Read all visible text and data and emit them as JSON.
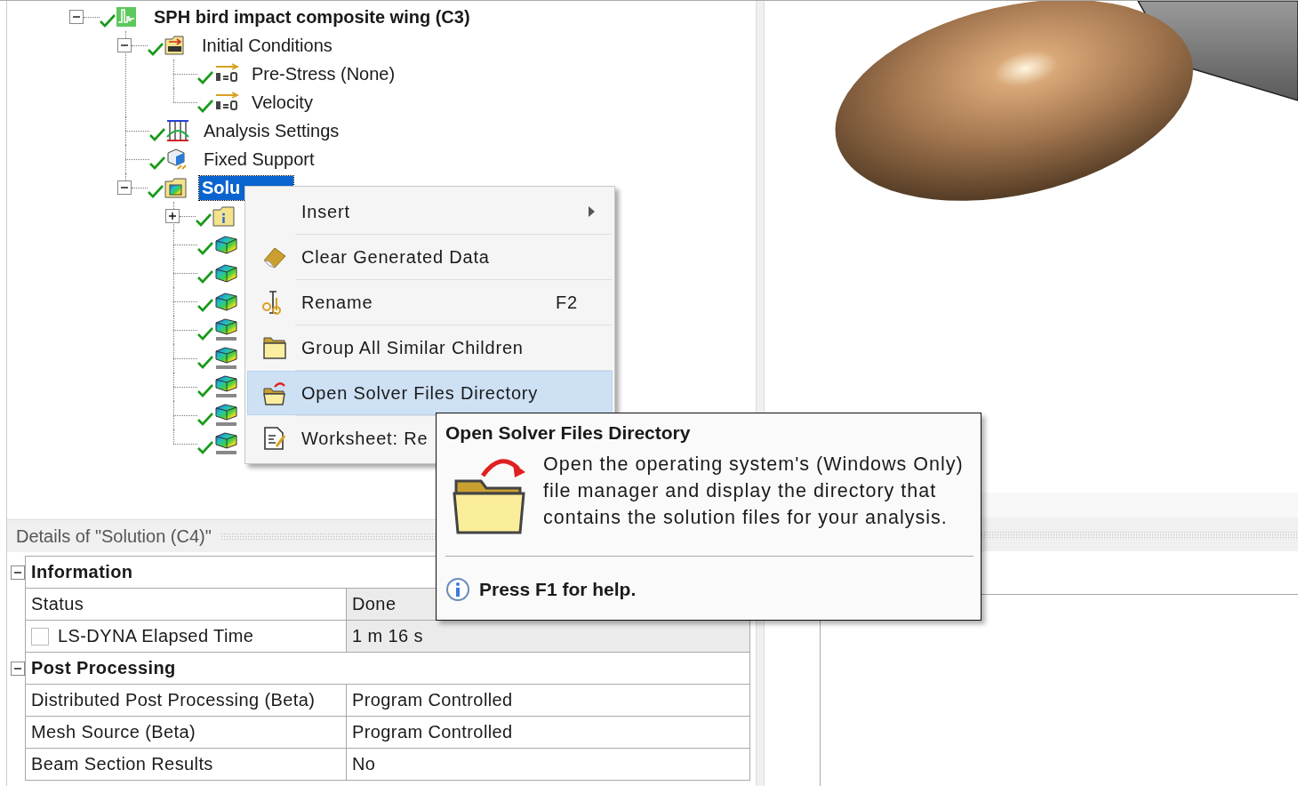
{
  "tree": {
    "nodes": [
      {
        "label": "SPH bird impact composite wing (C3)",
        "kind": "model",
        "solved": true,
        "expanded": true,
        "selected": false,
        "children": [
          {
            "label": "Initial Conditions",
            "kind": "initial-conditions",
            "solved": true,
            "expanded": true,
            "selected": false,
            "children": [
              {
                "label": "Pre-Stress (None)",
                "kind": "t0-arrow",
                "solved": true,
                "selected": false
              },
              {
                "label": "Velocity",
                "kind": "t0-arrow",
                "solved": true,
                "selected": false
              }
            ]
          },
          {
            "label": "Analysis Settings",
            "kind": "analysis-settings",
            "solved": true,
            "selected": false
          },
          {
            "label": "Fixed Support",
            "kind": "fixed-support",
            "solved": true,
            "selected": false
          },
          {
            "label": "Solu",
            "kind": "solution",
            "solved": true,
            "expanded": true,
            "selected": true,
            "children": [
              {
                "kind": "solution-information",
                "solved": true,
                "expanded": false,
                "selected": false
              },
              {
                "kind": "result",
                "solved": true,
                "selected": false
              },
              {
                "kind": "result",
                "solved": true,
                "selected": false
              },
              {
                "kind": "result",
                "solved": true,
                "selected": false
              },
              {
                "kind": "user-result",
                "solved": true,
                "selected": false
              },
              {
                "kind": "user-result",
                "solved": true,
                "selected": false
              },
              {
                "kind": "user-result",
                "solved": true,
                "selected": false
              },
              {
                "kind": "user-result",
                "solved": true,
                "selected": false
              },
              {
                "kind": "user-result",
                "solved": true,
                "selected": false
              }
            ]
          }
        ]
      }
    ]
  },
  "context_menu": {
    "items": [
      {
        "label": "Insert",
        "kind": "submenu",
        "selected": false
      },
      {
        "label": "Clear Generated Data",
        "kind": "eraser",
        "selected": false
      },
      {
        "label": "Rename",
        "kind": "rename",
        "shortcut": "F2",
        "selected": false
      },
      {
        "label": "Group All Similar Children",
        "kind": "folder",
        "selected": false
      },
      {
        "label": "Open Solver Files Directory",
        "kind": "open-folder",
        "selected": true
      },
      {
        "label": "Worksheet: Re",
        "kind": "worksheet",
        "selected": false
      }
    ]
  },
  "tooltip": {
    "title": "Open Solver Files Directory",
    "description": "Open the operating system's (Windows Only) file manager and display the directory that contains the solution files for your analysis.",
    "help": "Press F1 for help."
  },
  "details": {
    "title": "Details of \"Solution (C4)\"",
    "groups": [
      {
        "name": "Information",
        "expanded": true,
        "rows": [
          {
            "label": "Status",
            "value": "Done",
            "kind": "plain",
            "read_only": true
          },
          {
            "label": "LS-DYNA Elapsed Time",
            "value": "1 m 16 s",
            "kind": "checkbox",
            "checked": false,
            "read_only": true
          }
        ]
      },
      {
        "name": "Post Processing",
        "expanded": true,
        "rows": [
          {
            "label": "Distributed Post Processing (Beta)",
            "value": "Program Controlled",
            "kind": "plain",
            "read_only": false
          },
          {
            "label": "Mesh Source (Beta)",
            "value": "Program Controlled",
            "kind": "plain",
            "read_only": false
          },
          {
            "label": "Beam Section Results",
            "value": "No",
            "kind": "plain",
            "read_only": false
          }
        ]
      }
    ]
  }
}
